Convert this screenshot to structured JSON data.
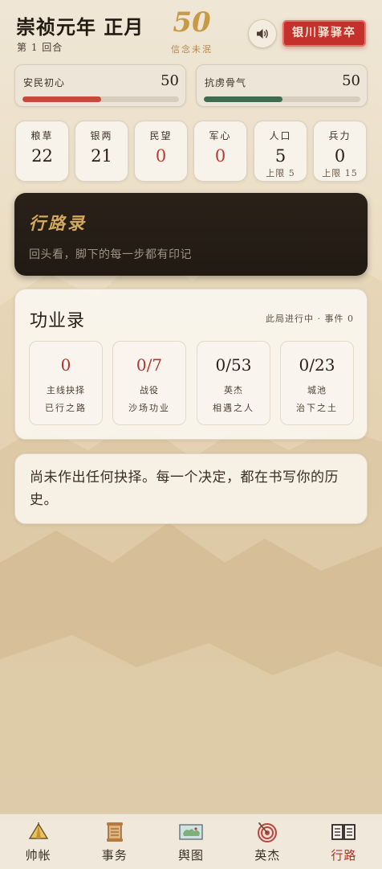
{
  "header": {
    "era_title": "崇祯元年 正月",
    "round_label": "第 1 回合",
    "score": "50",
    "score_caption": "信念未泯",
    "seal_button_label": "银川驿驿卒"
  },
  "meters": [
    {
      "label": "安民初心",
      "value": "50",
      "fill_fraction": 0.5,
      "color": "#c9483a"
    },
    {
      "label": "抗虏骨气",
      "value": "50",
      "fill_fraction": 0.5,
      "color": "#3f6b4e"
    }
  ],
  "resources": [
    {
      "label": "粮草",
      "value": "22",
      "limit": ""
    },
    {
      "label": "银两",
      "value": "21",
      "limit": ""
    },
    {
      "label": "民望",
      "value": "0",
      "limit": ""
    },
    {
      "label": "军心",
      "value": "0",
      "limit": ""
    },
    {
      "label": "人口",
      "value": "5",
      "limit": "上限 5"
    },
    {
      "label": "兵力",
      "value": "0",
      "limit": "上限 15"
    }
  ],
  "journey": {
    "title": "行路录",
    "subtitle": "回头看，脚下的每一步都有印记"
  },
  "merit": {
    "title": "功业录",
    "status": "此局进行中 · 事件 0",
    "stats": [
      {
        "value": "0",
        "name": "主线抉择",
        "desc": "已行之路"
      },
      {
        "value": "0/7",
        "name": "战役",
        "desc": "沙场功业"
      },
      {
        "value": "0/53",
        "name": "英杰",
        "desc": "相遇之人"
      },
      {
        "value": "0/23",
        "name": "城池",
        "desc": "治下之土"
      }
    ]
  },
  "empty_message": "尚未作出任何抉择。每一个决定，都在书写你的历史。",
  "nav": [
    {
      "label": "帅帐",
      "icon": "tent-icon"
    },
    {
      "label": "事务",
      "icon": "scroll-icon"
    },
    {
      "label": "舆图",
      "icon": "map-icon"
    },
    {
      "label": "英杰",
      "icon": "target-icon"
    },
    {
      "label": "行路",
      "icon": "book-icon",
      "active": true
    }
  ],
  "colors": {
    "accent_red": "#c4302b",
    "gold": "#c89a45",
    "dark_card": "#241c15",
    "value_red": "#c0392b"
  }
}
